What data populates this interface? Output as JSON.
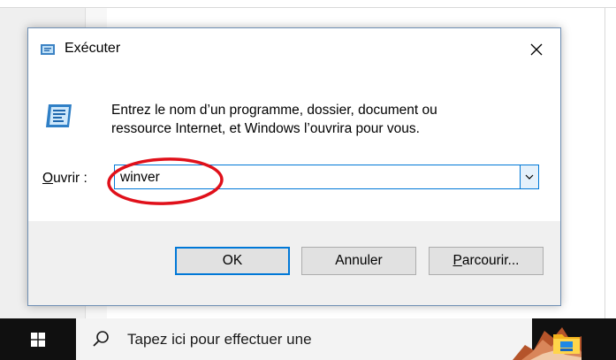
{
  "dialog": {
    "title": "Exécuter",
    "description_line1": "Entrez le nom d’un programme, dossier, document ou",
    "description_line2": "ressource Internet, et Windows l’ouvrira pour vous.",
    "open_label_accel": "O",
    "open_label_rest": "uvrir :",
    "input_value": "winver",
    "buttons": {
      "ok": "OK",
      "cancel": "Annuler",
      "browse_accel": "P",
      "browse_rest": "arcourir..."
    }
  },
  "taskbar": {
    "search_placeholder": "Tapez ici pour effectuer une"
  },
  "colors": {
    "accent": "#0078d7",
    "annotation": "#e0101a",
    "taskbar": "#101010"
  },
  "icons": [
    "run-icon",
    "close-icon",
    "chevron-down-icon",
    "windows-logo-icon",
    "search-icon",
    "file-explorer-icon"
  ]
}
